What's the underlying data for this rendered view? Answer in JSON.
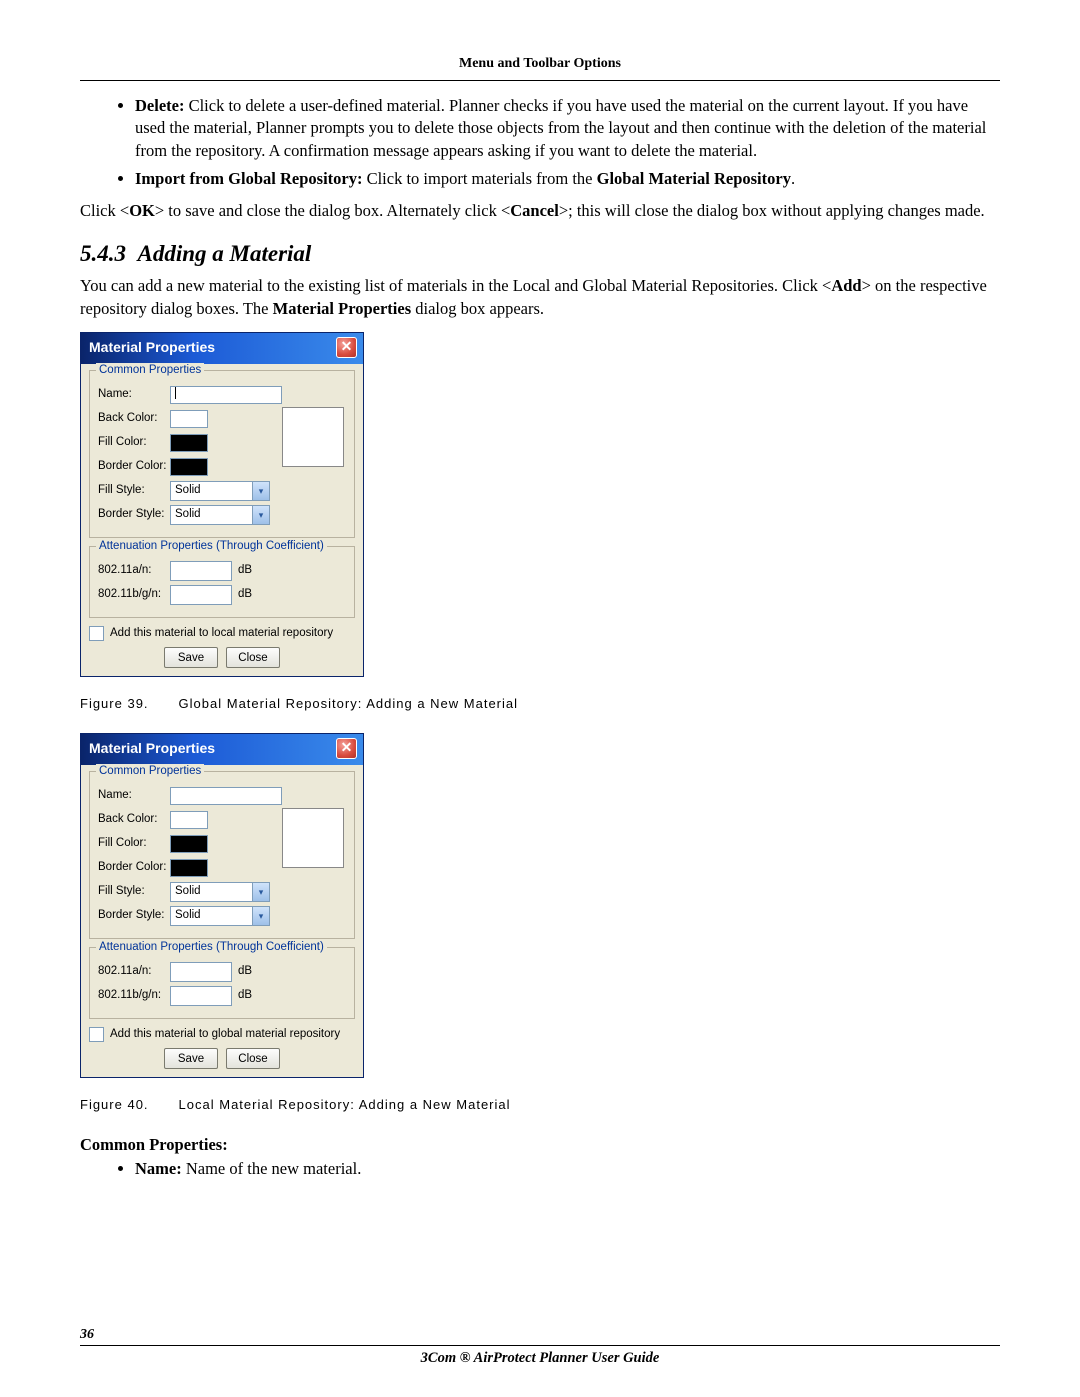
{
  "header": "Menu and Toolbar Options",
  "bullets_top": [
    {
      "label": "Delete:",
      "text": " Click to delete a user-defined material. Planner checks if you have used the material on the current layout. If you have used the material, Planner prompts you to delete those objects from the layout and then continue with the deletion of the material from the repository. A confirmation message appears asking if you want to delete the material."
    },
    {
      "label": "Import from Global Repository:",
      "text": " Click to import materials from the ",
      "bold_tail": "Global Material Repository",
      "tail": "."
    }
  ],
  "ok_para_pre": "Click <",
  "ok_bold": "OK",
  "ok_mid": "> to save and close the dialog box. Alternately click <",
  "cancel_bold": "Cancel",
  "ok_tail": ">; this will close the dialog box without applying changes made.",
  "section_number": "5.4.3",
  "section_title": "Adding a Material",
  "section_para_pre": "You can add a new material to the existing list of materials in the Local and Global Material Repositories. Click <",
  "add_bold": "Add",
  "section_para_mid": "> on the respective repository dialog boxes. The ",
  "matprop_bold": "Material Properties",
  "section_para_tail": " dialog box appears.",
  "dialog": {
    "title": "Material Properties",
    "common_legend": "Common Properties",
    "att_legend": "Attenuation Properties (Through Coefficient)",
    "labels": {
      "name": "Name:",
      "back": "Back Color:",
      "fill": "Fill Color:",
      "border": "Border Color:",
      "fstyle": "Fill Style:",
      "bstyle": "Border Style:",
      "a": "802.11a/n:",
      "b": "802.11b/g/n:",
      "db": "dB"
    },
    "fill_style": "Solid",
    "border_style": "Solid",
    "checkbox_local": "Add this material to local material repository",
    "checkbox_global": "Add this material to global material repository",
    "save": "Save",
    "close": "Close"
  },
  "fig39_label": "Figure 39.",
  "fig39_text": "Global Material Repository: Adding a New Material",
  "fig40_label": "Figure 40.",
  "fig40_text": "Local Material Repository: Adding a New Material",
  "common_props_heading": "Common Properties:",
  "name_bullet_label": "Name:",
  "name_bullet_text": " Name of the new material.",
  "page_number": "36",
  "footer": "3Com ® AirProtect Planner User Guide"
}
